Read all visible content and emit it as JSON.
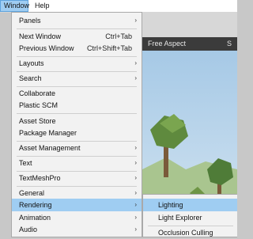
{
  "menubar": {
    "window_label": "Window",
    "help_label": "Help"
  },
  "scene_view": {
    "aspect_label": "Free Aspect",
    "scale_prefix": "S"
  },
  "window_menu": {
    "items": [
      {
        "label": "Panels",
        "shortcut": "",
        "submenu": true
      },
      {
        "label": "Next Window",
        "shortcut": "Ctrl+Tab",
        "submenu": false
      },
      {
        "label": "Previous Window",
        "shortcut": "Ctrl+Shift+Tab",
        "submenu": false
      },
      {
        "label": "Layouts",
        "shortcut": "",
        "submenu": true
      },
      {
        "label": "Search",
        "shortcut": "",
        "submenu": true
      },
      {
        "label": "Collaborate",
        "shortcut": "",
        "submenu": false
      },
      {
        "label": "Plastic SCM",
        "shortcut": "",
        "submenu": false
      },
      {
        "label": "Asset Store",
        "shortcut": "",
        "submenu": false
      },
      {
        "label": "Package Manager",
        "shortcut": "",
        "submenu": false
      },
      {
        "label": "Asset Management",
        "shortcut": "",
        "submenu": true
      },
      {
        "label": "Text",
        "shortcut": "",
        "submenu": true
      },
      {
        "label": "TextMeshPro",
        "shortcut": "",
        "submenu": true
      },
      {
        "label": "General",
        "shortcut": "",
        "submenu": true
      },
      {
        "label": "Rendering",
        "shortcut": "",
        "submenu": true
      },
      {
        "label": "Animation",
        "shortcut": "",
        "submenu": true
      },
      {
        "label": "Audio",
        "shortcut": "",
        "submenu": true
      }
    ],
    "arrow_glyph": "›"
  },
  "rendering_submenu": {
    "items": [
      {
        "label": "Lighting"
      },
      {
        "label": "Light Explorer"
      },
      {
        "label": "Occlusion Culling"
      }
    ]
  },
  "colors": {
    "highlight": "#9fcdf2",
    "menu_bg": "#f2f2f2"
  }
}
